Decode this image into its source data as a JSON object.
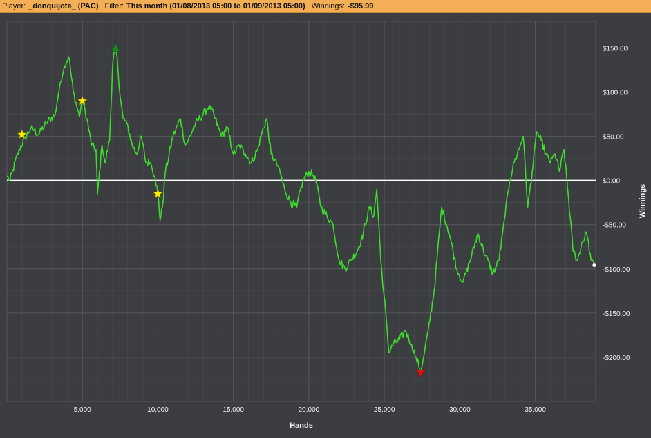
{
  "header": {
    "player_label": "Player:",
    "player_value": "_donquijote_ (PAC)",
    "filter_label": "Filter:",
    "filter_value": "This month (01/08/2013 05:00 to 01/09/2013 05:00)",
    "winnings_label": "Winnings:",
    "winnings_value": "-$95.99"
  },
  "colors": {
    "header_bg": "#f4ae55",
    "plot_bg": "#3b3d40",
    "grid": "#56595d",
    "series": "#3ddc2c",
    "zero_line": "#ffffff",
    "star": "#ffea00",
    "max_marker": "#1f8a1f",
    "min_marker": "#e01010"
  },
  "chart_data": {
    "type": "line",
    "title": "",
    "xlabel": "Hands",
    "ylabel": "Winnings",
    "xlim": [
      0,
      39000
    ],
    "ylim": [
      -250,
      180
    ],
    "x_ticks": [
      5000,
      10000,
      15000,
      20000,
      25000,
      30000,
      35000
    ],
    "x_tick_labels": [
      "5,000",
      "10,000",
      "15,000",
      "20,000",
      "25,000",
      "30,000",
      "35,000"
    ],
    "y_ticks": [
      150,
      100,
      50,
      0,
      -50,
      -100,
      -150,
      -200
    ],
    "y_tick_labels": [
      "$150.00",
      "$100.00",
      "$50.00",
      "$0.00",
      "-$50.00",
      "-$100.00",
      "-$150.00",
      "-$200.00"
    ],
    "grid": true,
    "legend": "none",
    "series": [
      {
        "x": [
          0,
          200,
          800,
          1200,
          1600,
          2100,
          2600,
          3200,
          3500,
          3800,
          4100,
          4400,
          4800,
          5000,
          5300,
          5600,
          5900,
          6000,
          6300,
          6500,
          6800,
          7000,
          7150,
          7300,
          7500,
          7700,
          7950,
          8300,
          8600,
          8900,
          9200,
          9500,
          9800,
          10000,
          10150,
          10300,
          10500,
          11000,
          11500,
          11800,
          12000,
          12500,
          13000,
          13400,
          13800,
          14200,
          14600,
          15000,
          15400,
          15800,
          16200,
          16600,
          16900,
          17200,
          17500,
          18000,
          18400,
          18800,
          19200,
          19600,
          20000,
          20400,
          20800,
          21200,
          21600,
          22000,
          22400,
          22800,
          23200,
          23600,
          24000,
          24300,
          24500,
          24700,
          24900,
          25100,
          25300,
          25600,
          26000,
          26400,
          26800,
          27100,
          27400,
          27600,
          27900,
          28300,
          28800,
          29300,
          29800,
          30200,
          30700,
          31200,
          31700,
          32200,
          32600,
          33000,
          33300,
          33600,
          33900,
          34200,
          34500,
          34800,
          35100,
          35400,
          35700,
          36000,
          36300,
          36600,
          36900,
          37200,
          37500,
          37800,
          38100,
          38400,
          38700,
          38900
        ],
        "values": [
          5,
          0,
          35,
          48,
          60,
          52,
          65,
          75,
          108,
          130,
          140,
          100,
          72,
          90,
          70,
          40,
          35,
          -15,
          40,
          20,
          45,
          130,
          150,
          140,
          95,
          70,
          65,
          40,
          30,
          50,
          20,
          20,
          5,
          -15,
          -45,
          -30,
          10,
          50,
          70,
          40,
          45,
          65,
          75,
          85,
          70,
          50,
          60,
          30,
          40,
          30,
          20,
          35,
          55,
          70,
          30,
          15,
          -10,
          -25,
          -30,
          0,
          10,
          5,
          -30,
          -40,
          -50,
          -90,
          -100,
          -90,
          -80,
          -60,
          -30,
          -40,
          -10,
          -70,
          -120,
          -150,
          -195,
          -185,
          -180,
          -170,
          -185,
          -200,
          -215,
          -200,
          -170,
          -125,
          -30,
          -60,
          -100,
          -115,
          -90,
          -60,
          -85,
          -105,
          -90,
          -40,
          0,
          20,
          35,
          50,
          -30,
          10,
          55,
          45,
          30,
          20,
          30,
          10,
          35,
          -20,
          -80,
          -90,
          -70,
          -60,
          -90,
          -96
        ]
      }
    ],
    "markers": [
      {
        "type": "star",
        "x": 1000,
        "y": 52
      },
      {
        "type": "star",
        "x": 5000,
        "y": 90
      },
      {
        "type": "star",
        "x": 10000,
        "y": -15
      },
      {
        "type": "max",
        "x": 7200,
        "y": 150
      },
      {
        "type": "min",
        "x": 27400,
        "y": -218
      },
      {
        "type": "end",
        "x": 38900,
        "y": -96
      }
    ]
  }
}
